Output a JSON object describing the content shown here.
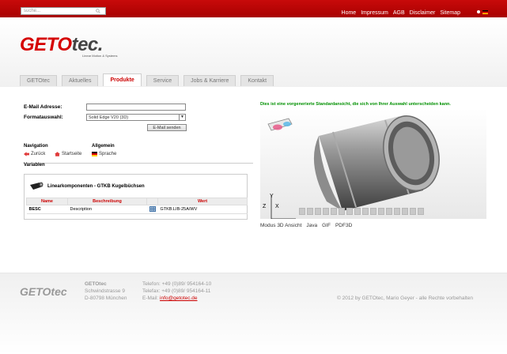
{
  "topbar": {
    "search_placeholder": "suche...",
    "links": [
      "Home",
      "Impressum",
      "AGB",
      "Disclaimer",
      "Sitemap"
    ]
  },
  "brand": {
    "logo_part1": "GETO",
    "logo_part2": "tec.",
    "tagline": "Linear Motion & Systems"
  },
  "tabs": [
    "GETOtec",
    "Aktuelles",
    "Produkte",
    "Service",
    "Jobs & Karriere",
    "Kontakt"
  ],
  "active_tab": "Produkte",
  "form": {
    "email_label": "E-Mail Adresse:",
    "email_value": "",
    "format_label": "Formatauswahl:",
    "format_value": "Solid Edge V20 (3D)",
    "send_label": "E-Mail senden"
  },
  "navigation": {
    "nav_header": "Navigation",
    "general_header": "Allgemein",
    "back": "Zurück",
    "home": "Startseite",
    "language": "Sprache",
    "variables": "Variablen"
  },
  "product": {
    "title": "Linearkomponenten - GTKB Kugelbüchsen",
    "columns": [
      "Name",
      "Beschreibung",
      "Wert"
    ],
    "rows": [
      {
        "name": "BESC",
        "description": "Description",
        "value": "GTKB.LIB-25A/WV"
      }
    ]
  },
  "viewer": {
    "note": "Dies ist eine vorgenerierte Standardansicht, die sich von Ihrer Auswahl unterscheiden kann.",
    "axis_y": "Y",
    "axis_z": "Z",
    "axis_x": "X",
    "modes": [
      "Modus 3D Ansicht",
      "Java",
      "GIF",
      "PDF3D"
    ]
  },
  "footer": {
    "logo": "GETOtec",
    "company": "GETOtec",
    "street": "Schwindstrasse 9",
    "city": "D-80798 München",
    "phone": "Telefon: +49 (0)89/ 954164-10",
    "fax": "Telefax: +49 (0)89/ 954164-11",
    "email_label": "E-Mail:",
    "email": "info@getotec.de",
    "copyright": "© 2012 by GETOtec, Mario Geyer - alle Rechte vorbehalten"
  },
  "colors": {
    "brand_red": "#c80a0a",
    "note_green": "#009000"
  }
}
